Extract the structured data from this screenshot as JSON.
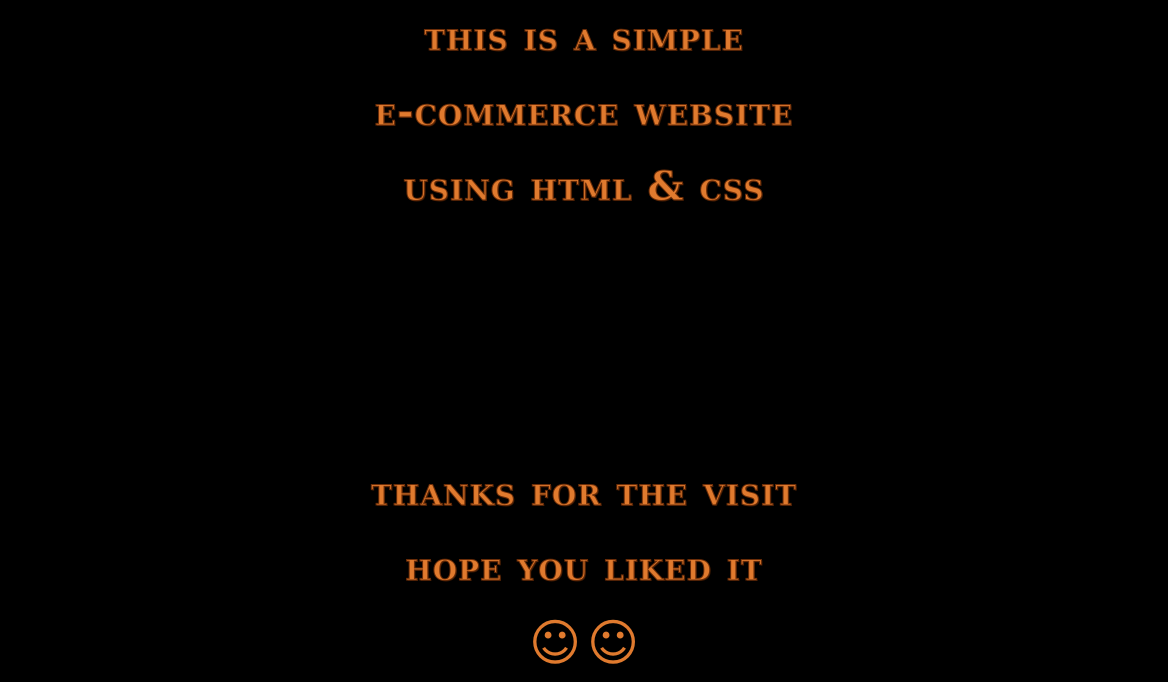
{
  "intro": {
    "line1": "This is a simple",
    "line2": "E-commerce Website",
    "line3": "using HTML & CSS"
  },
  "outro": {
    "line1": "Thanks for the Visit",
    "line2": "hope you liked it"
  },
  "smileys": [
    "☺",
    "☺"
  ],
  "colors": {
    "background": "#000000",
    "text": "#e07a2e",
    "outline": "#6b2d08"
  }
}
